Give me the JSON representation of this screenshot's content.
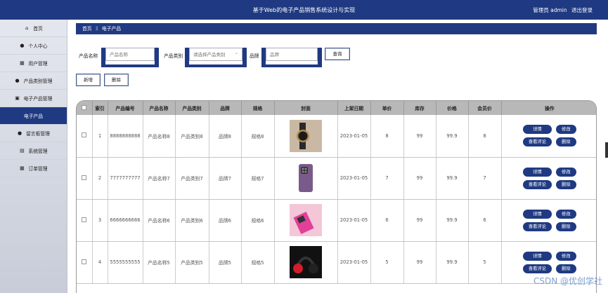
{
  "header": {
    "title": "基于Web的电子产品销售系统设计与实现",
    "user_label": "管理员 admin",
    "logout_label": "退出登录"
  },
  "sidebar": {
    "items": [
      {
        "label": "首页",
        "icon": "home-icon"
      },
      {
        "label": "个人中心",
        "icon": "user-icon"
      },
      {
        "label": "用户管理",
        "icon": "grid-icon"
      },
      {
        "label": "产品类别管理",
        "icon": "user-icon"
      },
      {
        "label": "电子产品管理",
        "icon": "box-icon"
      },
      {
        "label": "电子产品",
        "icon": "",
        "active": true
      },
      {
        "label": "留言板管理",
        "icon": "user-icon"
      },
      {
        "label": "系统管理",
        "icon": "cabinet-icon"
      },
      {
        "label": "订单管理",
        "icon": "grid-icon"
      }
    ]
  },
  "breadcrumb": {
    "home": "首页",
    "current": "电子产品"
  },
  "search": {
    "name_label": "产品名称",
    "name_placeholder": "产品名称",
    "type_label": "产品类别",
    "type_placeholder": "请选择产品类别",
    "brand_label": "品牌",
    "brand_placeholder": "品牌",
    "query_label": "查询"
  },
  "actions": {
    "add_label": "新增",
    "delete_label": "删除"
  },
  "table": {
    "headers": [
      "",
      "索引",
      "产品编号",
      "产品名称",
      "产品类别",
      "品牌",
      "规格",
      "封面",
      "上架日期",
      "单价",
      "库存",
      "价格",
      "会员价",
      "操作"
    ],
    "op_labels": [
      "详情",
      "修改",
      "查看评论",
      "删除"
    ],
    "rows": [
      {
        "index": "1",
        "code": "8888888888",
        "name": "产品名称8",
        "type": "产品类别8",
        "brand": "品牌8",
        "spec": "规格8",
        "cover": "watch",
        "date": "2023-01-05",
        "unit": "8",
        "stock": "99",
        "price": "99.9",
        "member": "8"
      },
      {
        "index": "2",
        "code": "7777777777",
        "name": "产品名称7",
        "type": "产品类别7",
        "brand": "品牌7",
        "spec": "规格7",
        "cover": "phone",
        "date": "2023-01-05",
        "unit": "7",
        "stock": "99",
        "price": "99.9",
        "member": "7"
      },
      {
        "index": "3",
        "code": "6666666666",
        "name": "产品名称6",
        "type": "产品类别6",
        "brand": "品牌6",
        "spec": "规格6",
        "cover": "pink-phone",
        "date": "2023-01-05",
        "unit": "6",
        "stock": "99",
        "price": "99.9",
        "member": "6"
      },
      {
        "index": "4",
        "code": "5555555555",
        "name": "产品名称5",
        "type": "产品类别5",
        "brand": "品牌5",
        "spec": "规格5",
        "cover": "headphones",
        "date": "2023-01-05",
        "unit": "5",
        "stock": "99",
        "price": "99.9",
        "member": "5"
      }
    ]
  },
  "watermark": "CSDN @优创学社",
  "colors": {
    "primary": "#1f3a82",
    "header_bg": "#1f3a82",
    "table_head": "#b8b8b8"
  }
}
